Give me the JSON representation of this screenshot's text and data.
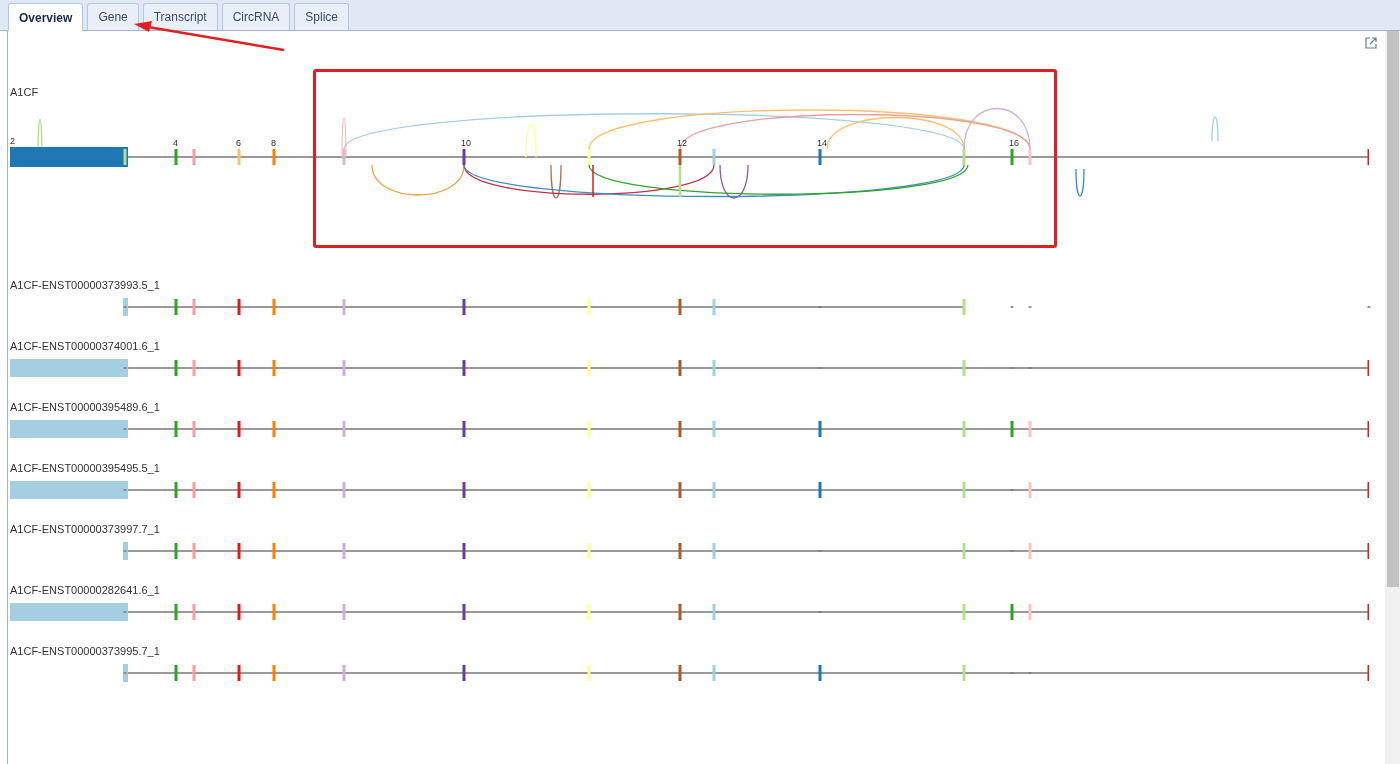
{
  "tabs": [
    {
      "label": "Overview",
      "selected": true
    },
    {
      "label": "Gene",
      "selected": false
    },
    {
      "label": "Transcript",
      "selected": false
    },
    {
      "label": "CircRNA",
      "selected": false
    },
    {
      "label": "Splice",
      "selected": false
    }
  ],
  "gene": {
    "name": "A1CF",
    "first_exon": {
      "kind": "long",
      "color": "#1f78b4",
      "label": "2"
    },
    "exons": [
      {
        "present": true,
        "color": "#b2df8a"
      },
      {
        "present": true,
        "color": "#33a02c",
        "label": "4"
      },
      {
        "present": true,
        "color": "#fb9a99"
      },
      {
        "present": true,
        "color": "#fdbf6f",
        "label": "6"
      },
      {
        "present": true,
        "color": "#ff7f00",
        "label": "8"
      },
      {
        "present": true,
        "color": "#d9b8c4"
      },
      {
        "present": true,
        "color": "#6a3d9a",
        "label": "10"
      },
      {
        "present": true,
        "color": "#ffff99"
      },
      {
        "present": true,
        "color": "#b15928",
        "label": "12"
      },
      {
        "present": true,
        "color": "#a6cee3"
      },
      {
        "present": true,
        "color": "#1f78b4",
        "label": "14"
      },
      {
        "present": true,
        "color": "#b2df8a"
      },
      {
        "present": true,
        "color": "#33a02c",
        "label": "16"
      },
      {
        "present": true,
        "color": "#fbc4c4"
      },
      {
        "present": true,
        "color": "#e31a1c"
      }
    ]
  },
  "transcripts": [
    {
      "name": "A1CF-ENST00000373993.5_1",
      "first_exon": {
        "kind": "short",
        "color": "#a6cee3"
      },
      "exons": [
        {
          "present": false
        },
        {
          "present": true,
          "color": "#33a02c"
        },
        {
          "present": true,
          "color": "#fb9a99"
        },
        {
          "present": true,
          "color": "#e31a1c"
        },
        {
          "present": true,
          "color": "#ff7f00"
        },
        {
          "present": true,
          "color": "#cab2d6"
        },
        {
          "present": true,
          "color": "#6a3d9a"
        },
        {
          "present": true,
          "color": "#ffff99"
        },
        {
          "present": true,
          "color": "#b15928"
        },
        {
          "present": true,
          "color": "#a6cee3"
        },
        {
          "present": false
        },
        {
          "present": true,
          "color": "#b2df8a"
        },
        {
          "present": false
        },
        {
          "present": false
        },
        {
          "present": false
        }
      ]
    },
    {
      "name": "A1CF-ENST00000374001.6_1",
      "first_exon": {
        "kind": "long",
        "color": "#a6cee3"
      },
      "exons": [
        {
          "present": false
        },
        {
          "present": true,
          "color": "#33a02c"
        },
        {
          "present": true,
          "color": "#fb9a99"
        },
        {
          "present": true,
          "color": "#e31a1c"
        },
        {
          "present": true,
          "color": "#ff7f00"
        },
        {
          "present": true,
          "color": "#cab2d6"
        },
        {
          "present": true,
          "color": "#6a3d9a"
        },
        {
          "present": true,
          "color": "#ffff99"
        },
        {
          "present": true,
          "color": "#b15928"
        },
        {
          "present": true,
          "color": "#a6cee3"
        },
        {
          "present": false
        },
        {
          "present": true,
          "color": "#b2df8a"
        },
        {
          "present": false
        },
        {
          "present": false
        },
        {
          "present": true,
          "color": "#e31a1c"
        }
      ]
    },
    {
      "name": "A1CF-ENST00000395489.6_1",
      "first_exon": {
        "kind": "long",
        "color": "#a6cee3"
      },
      "exons": [
        {
          "present": false
        },
        {
          "present": true,
          "color": "#33a02c"
        },
        {
          "present": true,
          "color": "#fb9a99"
        },
        {
          "present": true,
          "color": "#e31a1c"
        },
        {
          "present": true,
          "color": "#ff7f00"
        },
        {
          "present": true,
          "color": "#cab2d6"
        },
        {
          "present": true,
          "color": "#6a3d9a"
        },
        {
          "present": true,
          "color": "#ffff99"
        },
        {
          "present": true,
          "color": "#b15928"
        },
        {
          "present": true,
          "color": "#a6cee3"
        },
        {
          "present": true,
          "color": "#1f78b4"
        },
        {
          "present": true,
          "color": "#b2df8a"
        },
        {
          "present": true,
          "color": "#33a02c"
        },
        {
          "present": true,
          "color": "#fbc4c4"
        },
        {
          "present": true,
          "color": "#e31a1c"
        }
      ]
    },
    {
      "name": "A1CF-ENST00000395495.5_1",
      "first_exon": {
        "kind": "long",
        "color": "#a6cee3"
      },
      "exons": [
        {
          "present": false
        },
        {
          "present": true,
          "color": "#33a02c"
        },
        {
          "present": true,
          "color": "#fb9a99"
        },
        {
          "present": true,
          "color": "#e31a1c"
        },
        {
          "present": true,
          "color": "#ff7f00"
        },
        {
          "present": true,
          "color": "#cab2d6"
        },
        {
          "present": true,
          "color": "#6a3d9a"
        },
        {
          "present": true,
          "color": "#ffff99"
        },
        {
          "present": true,
          "color": "#b15928"
        },
        {
          "present": true,
          "color": "#a6cee3"
        },
        {
          "present": true,
          "color": "#1f78b4"
        },
        {
          "present": true,
          "color": "#b2df8a"
        },
        {
          "present": false
        },
        {
          "present": true,
          "color": "#fbc4c4"
        },
        {
          "present": true,
          "color": "#e31a1c"
        }
      ]
    },
    {
      "name": "A1CF-ENST00000373997.7_1",
      "first_exon": {
        "kind": "short",
        "color": "#a6cee3"
      },
      "exons": [
        {
          "present": false
        },
        {
          "present": true,
          "color": "#33a02c"
        },
        {
          "present": true,
          "color": "#fb9a99"
        },
        {
          "present": true,
          "color": "#e31a1c"
        },
        {
          "present": true,
          "color": "#ff7f00"
        },
        {
          "present": true,
          "color": "#cab2d6"
        },
        {
          "present": true,
          "color": "#6a3d9a"
        },
        {
          "present": true,
          "color": "#ffff99"
        },
        {
          "present": true,
          "color": "#b15928"
        },
        {
          "present": true,
          "color": "#a6cee3"
        },
        {
          "present": false
        },
        {
          "present": true,
          "color": "#b2df8a"
        },
        {
          "present": false
        },
        {
          "present": true,
          "color": "#fbc4c4"
        },
        {
          "present": true,
          "color": "#e31a1c"
        }
      ]
    },
    {
      "name": "A1CF-ENST00000282641.6_1",
      "first_exon": {
        "kind": "long",
        "color": "#a6cee3"
      },
      "exons": [
        {
          "present": false
        },
        {
          "present": true,
          "color": "#33a02c"
        },
        {
          "present": true,
          "color": "#fb9a99"
        },
        {
          "present": true,
          "color": "#e31a1c"
        },
        {
          "present": true,
          "color": "#ff7f00"
        },
        {
          "present": true,
          "color": "#cab2d6"
        },
        {
          "present": true,
          "color": "#6a3d9a"
        },
        {
          "present": true,
          "color": "#ffff99"
        },
        {
          "present": true,
          "color": "#b15928"
        },
        {
          "present": true,
          "color": "#a6cee3"
        },
        {
          "present": false
        },
        {
          "present": true,
          "color": "#b2df8a"
        },
        {
          "present": true,
          "color": "#33a02c"
        },
        {
          "present": true,
          "color": "#fbc4c4"
        },
        {
          "present": true,
          "color": "#e31a1c"
        }
      ]
    },
    {
      "name": "A1CF-ENST00000373995.7_1",
      "first_exon": {
        "kind": "short",
        "color": "#a6cee3"
      },
      "exons": [
        {
          "present": false
        },
        {
          "present": true,
          "color": "#33a02c"
        },
        {
          "present": true,
          "color": "#fb9a99"
        },
        {
          "present": true,
          "color": "#e31a1c"
        },
        {
          "present": true,
          "color": "#ff7f00"
        },
        {
          "present": true,
          "color": "#cab2d6"
        },
        {
          "present": true,
          "color": "#6a3d9a"
        },
        {
          "present": true,
          "color": "#ffff99"
        },
        {
          "present": true,
          "color": "#b15928"
        },
        {
          "present": true,
          "color": "#a6cee3"
        },
        {
          "present": true,
          "color": "#1f78b4"
        },
        {
          "present": true,
          "color": "#b2df8a"
        },
        {
          "present": false
        },
        {
          "present": false
        },
        {
          "present": true,
          "color": "#e31a1c"
        }
      ]
    }
  ]
}
